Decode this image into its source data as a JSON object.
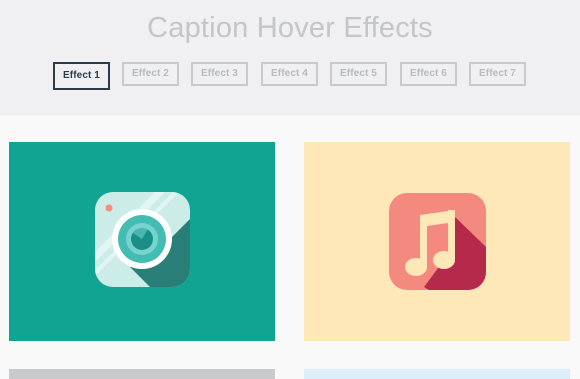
{
  "header": {
    "title": "Caption Hover Effects"
  },
  "tabs": [
    {
      "label": "Effect 1",
      "active": true
    },
    {
      "label": "Effect 2",
      "active": false
    },
    {
      "label": "Effect 3",
      "active": false
    },
    {
      "label": "Effect 4",
      "active": false
    },
    {
      "label": "Effect 5",
      "active": false
    },
    {
      "label": "Effect 6",
      "active": false
    },
    {
      "label": "Effect 7",
      "active": false
    }
  ],
  "gallery": {
    "items": [
      {
        "icon": "camera-icon",
        "background": "#10a493"
      },
      {
        "icon": "music-note-icon",
        "background": "#ffe8b7"
      },
      {
        "background": "#c9cacc"
      },
      {
        "background": "#dceefa"
      }
    ]
  },
  "colors": {
    "title": "#c3c5c9",
    "tab_active": "#2f3a4b",
    "tab_inactive": "#b7babf"
  }
}
